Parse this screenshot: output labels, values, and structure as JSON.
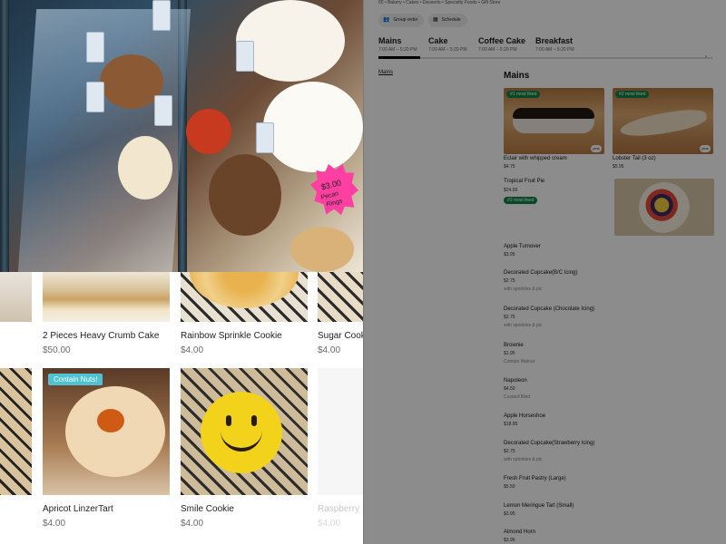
{
  "left_panel": {
    "hero": {
      "sign_text": "$3.00 Pecan Rings"
    },
    "row1": [
      {
        "title": "2 Pieces Heavy Crumb Cake",
        "price": "$50.00"
      },
      {
        "title": "Rainbow Sprinkle Cookie",
        "price": "$4.00"
      },
      {
        "title": "Sugar Cookie",
        "price": "$4.00"
      }
    ],
    "row2": [
      {
        "title": "Apricot LinzerTart",
        "price": "$4.00",
        "badge": "Contain Nuts!"
      },
      {
        "title": "Smile Cookie",
        "price": "$4.00"
      },
      {
        "title": "Raspberry",
        "price": "$4.00"
      }
    ]
  },
  "right_panel": {
    "breadcrumb": "€€ • Bakery • Cakes • Desserts • Specialty Foods • Gift Store",
    "actions": [
      {
        "label": "Group order",
        "icon": "group-icon"
      },
      {
        "label": "Schedule",
        "icon": "calendar-icon"
      }
    ],
    "menu_tabs": [
      {
        "name": "Mains",
        "hours": "7:00 AM – 5:20 PM"
      },
      {
        "name": "Cake",
        "hours": "7:00 AM – 5:20 PM"
      },
      {
        "name": "Coffee Cake",
        "hours": "7:00 AM – 5:20 PM"
      },
      {
        "name": "Breakfast",
        "hours": "7:00 AM – 5:20 PM"
      }
    ],
    "side_link": "Mains",
    "section_title": "Mains",
    "featured": [
      {
        "badge": "#1 most liked",
        "name": "Eclair with whipped cream",
        "price": "$4.75",
        "plus": "plus"
      },
      {
        "badge": "#2 most liked",
        "name": "Lobster Tail (3 oz)",
        "price": "$5.95",
        "plus": "plus"
      }
    ],
    "tropical": {
      "name": "Tropical Fruit Pie",
      "price": "$24.50",
      "badge": "#3 most liked"
    },
    "items": [
      {
        "name": "Apple Turnover",
        "price": "$3.95",
        "desc": ""
      },
      {
        "name": "Decorated Cupcake(B/C Icing)",
        "price": "$2.75",
        "desc": "with sprinkles & pic"
      },
      {
        "name": "Decorated Cupcake (Chocolate Icing)",
        "price": "$2.75",
        "desc": "with sprinkles & pic"
      },
      {
        "name": "Brownie",
        "price": "$1.95",
        "desc": "Contain Walnut"
      },
      {
        "name": "Napoleon",
        "price": "$4.50",
        "desc": "Custard filled"
      },
      {
        "name": "Apple Horseshoe",
        "price": "$18.95",
        "desc": ""
      },
      {
        "name": "Decorated Cupcake(Strawberry Icing)",
        "price": "$2.75",
        "desc": "with sprinkles & pic"
      },
      {
        "name": "Fresh Fruit Pastry (Large)",
        "price": "$5.50",
        "desc": ""
      },
      {
        "name": "Lemon Meringue Tart (Small)",
        "price": "$3.95",
        "desc": ""
      },
      {
        "name": "Almond Horn",
        "price": "$3.95",
        "desc": ""
      }
    ]
  },
  "colors": {
    "badge_green": "#0e8345",
    "nuts_badge": "#4fc3d1",
    "sign_pink": "#ff3fa1",
    "overlay": "rgba(0,0,0,0.45)"
  }
}
